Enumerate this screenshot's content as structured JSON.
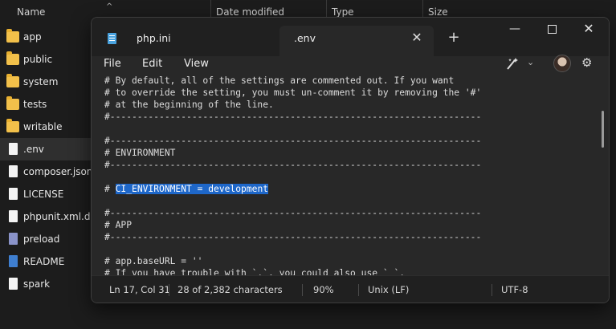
{
  "explorer": {
    "columns": {
      "name": "Name",
      "date": "Date modified",
      "type": "Type",
      "size": "Size"
    },
    "items": [
      {
        "label": "app",
        "kind": "folder"
      },
      {
        "label": "public",
        "kind": "folder"
      },
      {
        "label": "system",
        "kind": "folder"
      },
      {
        "label": "tests",
        "kind": "folder"
      },
      {
        "label": "writable",
        "kind": "folder"
      },
      {
        "label": ".env",
        "kind": "file",
        "selected": true
      },
      {
        "label": "composer.json",
        "kind": "file"
      },
      {
        "label": "LICENSE",
        "kind": "file"
      },
      {
        "label": "phpunit.xml.dist",
        "kind": "file"
      },
      {
        "label": "preload",
        "kind": "php"
      },
      {
        "label": "README",
        "kind": "readme"
      },
      {
        "label": "spark",
        "kind": "file"
      }
    ]
  },
  "notepad": {
    "tabs": [
      {
        "label": "php.ini",
        "active": false
      },
      {
        "label": ".env",
        "active": true
      }
    ],
    "window_controls": {
      "minimize": "—",
      "maximize": "",
      "close": "✕"
    },
    "new_tab": "+",
    "tab_close": "✕",
    "menu": {
      "file": "File",
      "edit": "Edit",
      "view": "View"
    },
    "icons": {
      "copilot": "copilot-icon",
      "chevron": "chevron-down-icon",
      "avatar": "avatar",
      "settings": "gear-icon"
    },
    "lines": [
      "# By default, all of the settings are commented out. If you want",
      "# to override the setting, you must un-comment it by removing the '#'",
      "# at the beginning of the line.",
      "#--------------------------------------------------------------------",
      "",
      "#--------------------------------------------------------------------",
      "# ENVIRONMENT",
      "#--------------------------------------------------------------------",
      "",
      "# CI_ENVIRONMENT = development",
      "",
      "#--------------------------------------------------------------------",
      "# APP",
      "#--------------------------------------------------------------------",
      "",
      "# app.baseURL = ''",
      "# If you have trouble with `.`, you could also use `_`."
    ],
    "selected_text": "CI_ENVIRONMENT = development",
    "status": {
      "position": "Ln 17, Col 31",
      "chars": "28 of 2,382 characters",
      "zoom": "90%",
      "eol": "Unix (LF)",
      "encoding": "UTF-8"
    },
    "colors": {
      "selection": "#1e67c9",
      "editor_bg": "#282828",
      "chrome_bg": "#202020"
    }
  }
}
